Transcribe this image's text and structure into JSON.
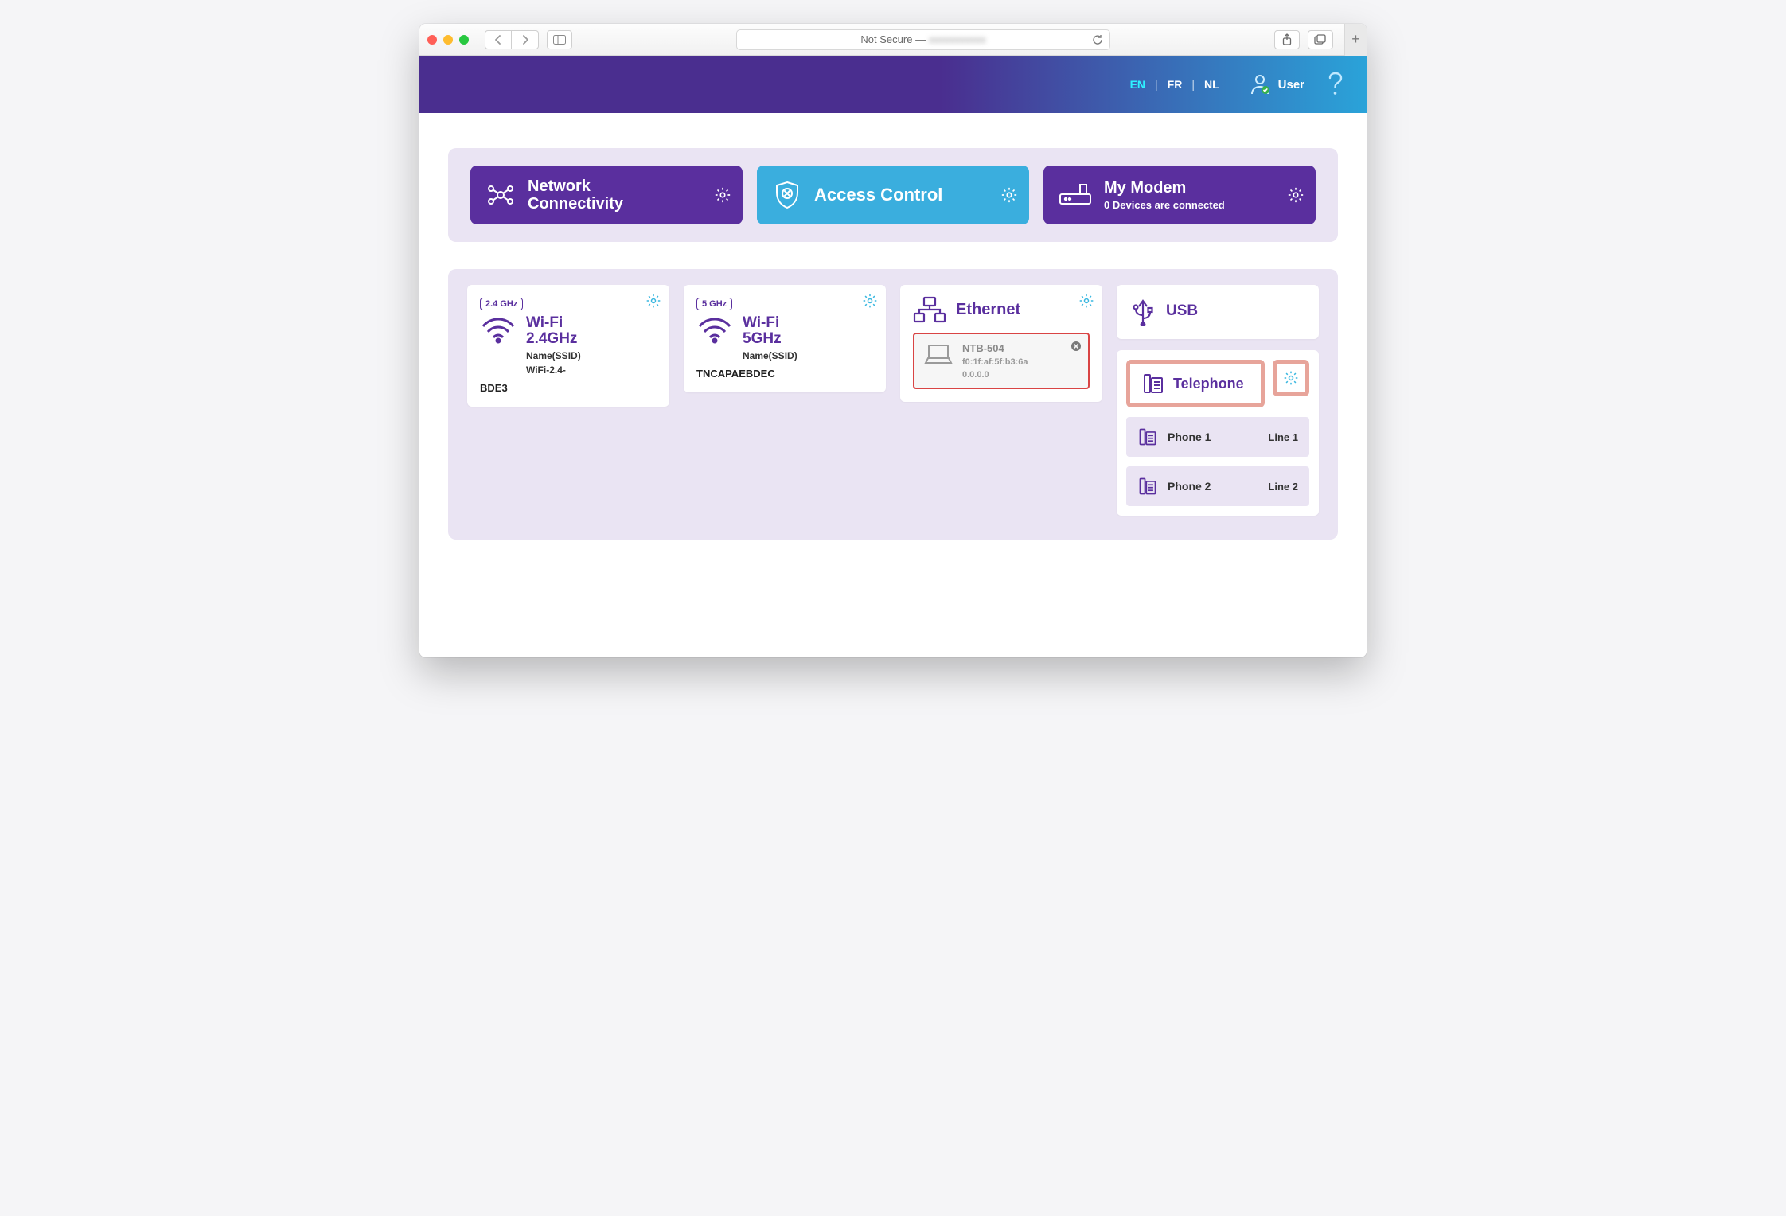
{
  "browser": {
    "address_prefix": "Not Secure —",
    "address_blur": "xxxxxxxxxxx"
  },
  "header": {
    "languages": {
      "en": "EN",
      "fr": "FR",
      "nl": "NL",
      "active": "EN"
    },
    "user_label": "User"
  },
  "topTiles": {
    "network": {
      "line1": "Network",
      "line2": "Connectivity"
    },
    "access": {
      "title": "Access Control"
    },
    "modem": {
      "title": "My Modem",
      "sub": "0 Devices are connected"
    }
  },
  "wifi24": {
    "badge": "2.4 GHz",
    "title1": "Wi-Fi",
    "title2": "2.4GHz",
    "ssid_label": "Name(SSID)",
    "ssid_value_top": "WiFi-2.4-",
    "ssid_value_bottom": "BDE3"
  },
  "wifi5": {
    "badge": "5 GHz",
    "title1": "Wi-Fi",
    "title2": "5GHz",
    "ssid_label": "Name(SSID)",
    "ssid_value": "TNCAPAEBDEC"
  },
  "ethernet": {
    "title": "Ethernet",
    "device": {
      "name": "NTB-504",
      "mac": "f0:1f:af:5f:b3:6a",
      "ip": "0.0.0.0"
    }
  },
  "usb": {
    "title": "USB"
  },
  "telephone": {
    "title": "Telephone",
    "phones": [
      {
        "name": "Phone 1",
        "line": "Line 1"
      },
      {
        "name": "Phone 2",
        "line": "Line 2"
      }
    ]
  }
}
